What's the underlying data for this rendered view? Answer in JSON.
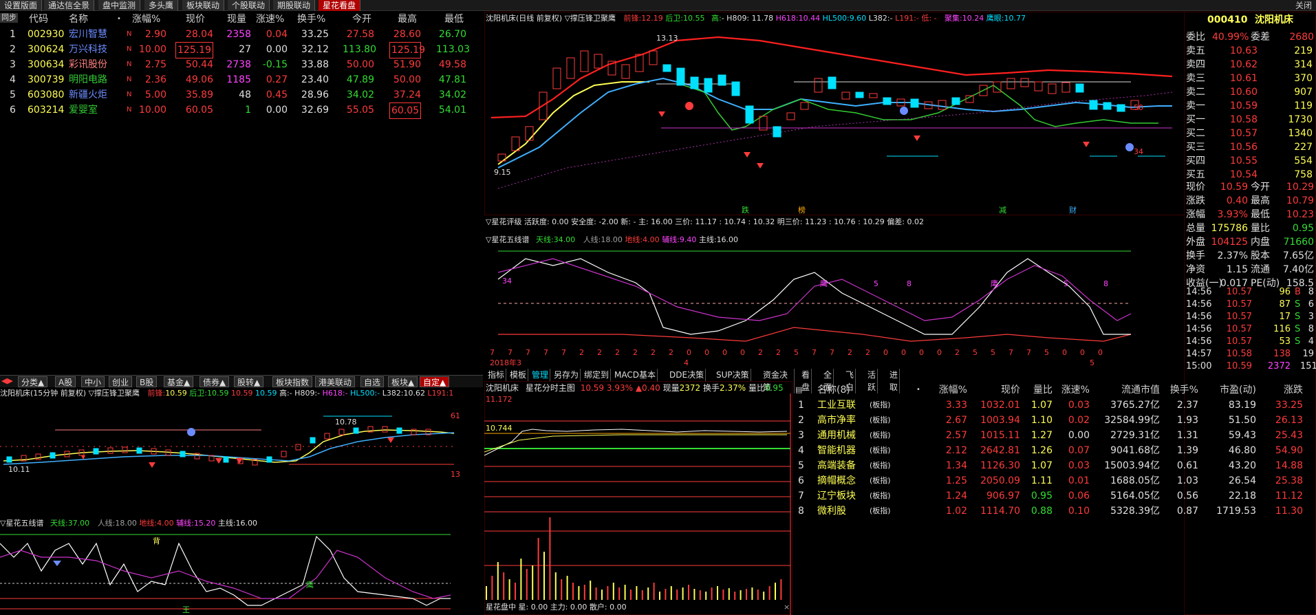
{
  "top_tabs": [
    "设置版面",
    "通达信全景",
    "盘中监测",
    "多头鹰",
    "板块联动",
    "个股联动",
    "期股联动",
    "星花看盘"
  ],
  "close_label": "关闭",
  "stock_table": {
    "side_label": "同步",
    "headers": [
      "代码",
      "名称",
      "•",
      "涨幅%",
      "现价",
      "现量",
      "涨速%",
      "换手%",
      "今开",
      "最高",
      "最低"
    ],
    "rows": [
      {
        "idx": "1",
        "code": "002930",
        "name": "宏川智慧",
        "flag": "N",
        "chg": "2.90",
        "price": "28.04",
        "vol": "2358",
        "speed": "0.04",
        "turn": "33.25",
        "open": "27.58",
        "high": "28.60",
        "low": "26.70"
      },
      {
        "idx": "2",
        "code": "300624",
        "name": "万兴科技",
        "flag": "N",
        "chg": "10.00",
        "price": "125.19",
        "vol": "27",
        "speed": "0.00",
        "turn": "32.12",
        "open": "113.80",
        "high": "125.19",
        "low": "113.03"
      },
      {
        "idx": "3",
        "code": "300634",
        "name": "彩讯股份",
        "flag": "N",
        "chg": "2.75",
        "price": "50.44",
        "vol": "2738",
        "speed": "-0.15",
        "turn": "33.88",
        "open": "50.00",
        "high": "51.90",
        "low": "49.58"
      },
      {
        "idx": "4",
        "code": "300739",
        "name": "明阳电路",
        "flag": "N",
        "chg": "2.36",
        "price": "49.06",
        "vol": "1185",
        "speed": "0.27",
        "turn": "23.40",
        "open": "47.89",
        "high": "50.00",
        "low": "47.81"
      },
      {
        "idx": "5",
        "code": "603080",
        "name": "新疆火炬",
        "flag": "N",
        "chg": "5.00",
        "price": "35.89",
        "vol": "48",
        "speed": "0.45",
        "turn": "28.96",
        "open": "34.02",
        "high": "37.24",
        "low": "34.02"
      },
      {
        "idx": "6",
        "code": "603214",
        "name": "爱婴室",
        "flag": "N",
        "chg": "10.00",
        "price": "60.05",
        "vol": "1",
        "speed": "0.00",
        "turn": "32.69",
        "open": "55.05",
        "high": "60.05",
        "low": "54.01"
      }
    ]
  },
  "mid_tabs": [
    "分类▲",
    "A股",
    "中小",
    "创业",
    "B股",
    "基金▲",
    "债券▲",
    "股转▲",
    "板块指数",
    "港美联动",
    "自选",
    "板块▲",
    "自定▲"
  ],
  "left_kline": {
    "title": "沈阳机床(15分钟 前复权) ▽撑压锋卫聚鹰",
    "vals": [
      {
        "label": "前锋:",
        "value": "10.59"
      },
      {
        "label": "后卫:",
        "value": "10.59"
      },
      {
        "label": "",
        "value": "10.59"
      },
      {
        "label": "",
        "value": "10.59"
      },
      {
        "label": "高:",
        "value": "- H809:-"
      },
      {
        "label": "H618:",
        "value": "-"
      },
      {
        "label": "HL500:",
        "value": "-"
      },
      {
        "label": "L382:",
        "value": "10.62"
      },
      {
        "label": "L191:",
        "value": "1"
      }
    ],
    "label_high": "10.78",
    "label_low": "10.11",
    "right_top": "61",
    "right_bot": "13"
  },
  "left_osc": {
    "title": "▽星花五线谱",
    "items": [
      {
        "label": "天线:",
        "value": "37.00"
      },
      {
        "label": "人线:",
        "value": "18.00"
      },
      {
        "label": "地线:",
        "value": "4.00"
      },
      {
        "label": "辅线:",
        "value": "15.20"
      },
      {
        "label": "主线:",
        "value": "16.00"
      }
    ],
    "marks": [
      "背",
      "鹰",
      "王"
    ]
  },
  "main_kline": {
    "title": "沈阳机床(日线 前复权) ▽撑压锋卫聚鹰",
    "vals": [
      {
        "label": "前锋:",
        "value": "12.19"
      },
      {
        "label": "后卫:",
        "value": "10.55"
      },
      {
        "label": "高:",
        "value": "- H809: 11.78"
      },
      {
        "label": "H618:",
        "value": "10.44"
      },
      {
        "label": "HL500:",
        "value": "9.60"
      },
      {
        "label": "L382:",
        "value": "-"
      },
      {
        "label": "L191:",
        "value": "- 低: -"
      },
      {
        "label": "聚集:",
        "value": "10.24"
      },
      {
        "label": "鹰眼:",
        "value": "10.77"
      }
    ],
    "hi_label": "13.13",
    "lo_label": "9.15",
    "r50": "50",
    "r34": "34",
    "bottom_marks": [
      "跌",
      "榜",
      "减",
      "财"
    ]
  },
  "rating_bar": {
    "text": "▽星花评级 活跃度: 0.00 安全度: -2.00 新: - 主: 16.00 三价: 11.17 : 10.74 : 10.32 明三价: 11.23 : 10.76 : 10.29 偏差: 0.02"
  },
  "main_osc": {
    "title": "▽星花五线谱",
    "items": [
      {
        "label": "天线:",
        "value": "34.00"
      },
      {
        "label": "人线:",
        "value": "18.00"
      },
      {
        "label": "地线:",
        "value": "4.00"
      },
      {
        "label": "辅线:",
        "value": "9.40"
      },
      {
        "label": "主线:",
        "value": "16.00"
      }
    ],
    "num_label": "34",
    "sub_labels": [
      "鹰",
      "5",
      "8",
      "鹰",
      "5",
      "8"
    ],
    "bottom_digits": [
      "7",
      "7",
      "7",
      "7",
      "7",
      "2",
      "2",
      "2",
      "2",
      "2",
      "2",
      "0",
      "0",
      "0",
      "0",
      "2",
      "2",
      "5",
      "7",
      "7",
      "2",
      "2",
      "0",
      "0",
      "0",
      "0",
      "2",
      "5",
      "5",
      "7",
      "7",
      "5",
      "0",
      "0",
      "0"
    ],
    "date_label": "2018年3",
    "month_label": "4",
    "month2_label": "5"
  },
  "bottom_tabs": [
    "指标",
    "模板",
    "管理",
    "另存为",
    "绑定到",
    "MACD基本",
    "DDE决策",
    "SUP决策",
    "资金决策",
    "看盘",
    "全面",
    "飞白",
    "活跃",
    "进取"
  ],
  "intraday": {
    "title": "沈阳机床",
    "sub": "星花分时主图",
    "price": "10.59",
    "pct": "3.93%",
    "chg": "▲0.40",
    "vol_label": "现量",
    "vol": "2372",
    "turn_label": "换手",
    "turn": "2.37%",
    "lb_label": "量比",
    "lb": "0.95",
    "top_price": "11.172",
    "level_price": "10.744",
    "footer": "星花盘中 星: 0.00 主力: 0.00 散户: 0.00"
  },
  "quote": {
    "code": "000410",
    "name": "沈阳机床",
    "wb_label": "委比",
    "wb": "40.99%",
    "wc_label": "委差",
    "wc": "2680",
    "asks": [
      {
        "label": "卖五",
        "price": "10.63",
        "vol": "219"
      },
      {
        "label": "卖四",
        "price": "10.62",
        "vol": "314"
      },
      {
        "label": "卖三",
        "price": "10.61",
        "vol": "370"
      },
      {
        "label": "卖二",
        "price": "10.60",
        "vol": "907"
      },
      {
        "label": "卖一",
        "price": "10.59",
        "vol": "119"
      }
    ],
    "bids": [
      {
        "label": "买一",
        "price": "10.58",
        "vol": "1730"
      },
      {
        "label": "买二",
        "price": "10.57",
        "vol": "1340"
      },
      {
        "label": "买三",
        "price": "10.56",
        "vol": "227"
      },
      {
        "label": "买四",
        "price": "10.55",
        "vol": "554"
      },
      {
        "label": "买五",
        "price": "10.54",
        "vol": "758"
      }
    ],
    "stats": [
      {
        "l1": "现价",
        "v1": "10.59",
        "l2": "今开",
        "v2": "10.29"
      },
      {
        "l1": "涨跌",
        "v1": "0.40",
        "l2": "最高",
        "v2": "10.79"
      },
      {
        "l1": "涨幅",
        "v1": "3.93%",
        "l2": "最低",
        "v2": "10.23"
      },
      {
        "l1": "总量",
        "v1": "175786",
        "l2": "量比",
        "v2": "0.95"
      },
      {
        "l1": "外盘",
        "v1": "104125",
        "l2": "内盘",
        "v2": "71660"
      },
      {
        "l1": "换手",
        "v1": "2.37%",
        "l2": "股本",
        "v2": "7.65亿"
      },
      {
        "l1": "净资",
        "v1": "1.15",
        "l2": "流通",
        "v2": "7.40亿"
      },
      {
        "l1": "收益(一)",
        "v1": "0.017",
        "l2": "PE(动)",
        "v2": "158.5"
      }
    ],
    "ticks": [
      {
        "t": "14:56",
        "p": "10.57",
        "v": "96",
        "s": "B",
        "n": "8"
      },
      {
        "t": "14:56",
        "p": "10.57",
        "v": "87",
        "s": "S",
        "n": "6"
      },
      {
        "t": "14:56",
        "p": "10.57",
        "v": "17",
        "s": "S",
        "n": "3"
      },
      {
        "t": "14:56",
        "p": "10.57",
        "v": "116",
        "s": "S",
        "n": "8"
      },
      {
        "t": "14:56",
        "p": "10.57",
        "v": "53",
        "s": "S",
        "n": "4"
      },
      {
        "t": "14:57",
        "p": "10.58",
        "v": "138",
        "s": "",
        "n": "19"
      },
      {
        "t": "15:00",
        "p": "10.59",
        "v": "2372",
        "s": "",
        "n": "151"
      }
    ]
  },
  "sectors": {
    "headers": [
      "名称(8)",
      "•",
      "涨幅%",
      "现价",
      "量比",
      "涨速%",
      "流通市值",
      "换手%",
      "市盈(动)",
      "涨跌"
    ],
    "rows": [
      {
        "idx": "1",
        "name": "工业互联",
        "tag": "(板指)",
        "chg": "3.33",
        "price": "1032.01",
        "lb": "1.07",
        "speed": "0.03",
        "mv": "3765.27亿",
        "turn": "2.37",
        "pe": "83.19",
        "zd": "33.25"
      },
      {
        "idx": "2",
        "name": "高市净率",
        "tag": "(板指)",
        "chg": "2.67",
        "price": "1003.94",
        "lb": "1.10",
        "speed": "0.02",
        "mv": "32584.99亿",
        "turn": "1.93",
        "pe": "51.50",
        "zd": "26.13"
      },
      {
        "idx": "3",
        "name": "通用机械",
        "tag": "(板指)",
        "chg": "2.57",
        "price": "1015.11",
        "lb": "1.27",
        "speed": "0.00",
        "mv": "2729.31亿",
        "turn": "1.31",
        "pe": "59.43",
        "zd": "25.43"
      },
      {
        "idx": "4",
        "name": "智能机器",
        "tag": "(板指)",
        "chg": "2.12",
        "price": "2642.81",
        "lb": "1.26",
        "speed": "0.07",
        "mv": "9041.68亿",
        "turn": "1.39",
        "pe": "46.80",
        "zd": "54.90"
      },
      {
        "idx": "5",
        "name": "高端装备",
        "tag": "(板指)",
        "chg": "1.34",
        "price": "1126.30",
        "lb": "1.07",
        "speed": "0.03",
        "mv": "15003.94亿",
        "turn": "0.61",
        "pe": "43.20",
        "zd": "14.88"
      },
      {
        "idx": "6",
        "name": "摘帽概念",
        "tag": "(板指)",
        "chg": "1.25",
        "price": "2050.09",
        "lb": "1.11",
        "speed": "0.01",
        "mv": "1688.05亿",
        "turn": "1.03",
        "pe": "26.54",
        "zd": "25.38"
      },
      {
        "idx": "7",
        "name": "辽宁板块",
        "tag": "(板指)",
        "chg": "1.24",
        "price": "906.97",
        "lb": "0.95",
        "speed": "0.06",
        "mv": "5164.05亿",
        "turn": "0.56",
        "pe": "22.18",
        "zd": "11.12"
      },
      {
        "idx": "8",
        "name": "微利股",
        "tag": "(板指)",
        "chg": "1.02",
        "price": "1114.70",
        "lb": "0.88",
        "speed": "0.10",
        "mv": "5328.39亿",
        "turn": "0.87",
        "pe": "1719.53",
        "zd": "11.30"
      }
    ]
  }
}
